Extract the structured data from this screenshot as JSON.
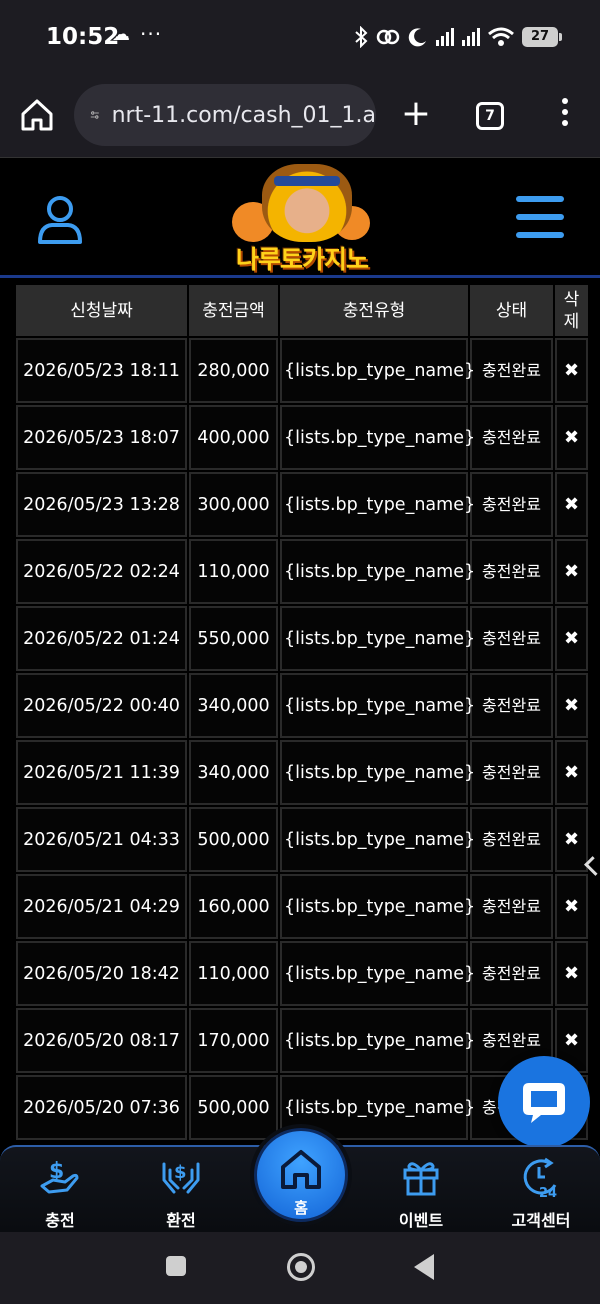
{
  "status_bar": {
    "time": "10:52",
    "cloud": "☁",
    "dots": "···",
    "battery": "27"
  },
  "browser": {
    "url": "nrt-11.com/cash_01_1.a",
    "tab_count": "7"
  },
  "site": {
    "logo_text": "나루토카지노",
    "accent_color": "#3d9cf0"
  },
  "table": {
    "headers": [
      "신청날짜",
      "충전금액",
      "충전유형",
      "상태",
      "삭\n제"
    ],
    "rows": [
      {
        "date": "2026/05/23 18:11",
        "amount": "280,000",
        "type": "{lists.bp_type_name}",
        "status": "충전완료",
        "delete": "✖"
      },
      {
        "date": "2026/05/23 18:07",
        "amount": "400,000",
        "type": "{lists.bp_type_name}",
        "status": "충전완료",
        "delete": "✖"
      },
      {
        "date": "2026/05/23 13:28",
        "amount": "300,000",
        "type": "{lists.bp_type_name}",
        "status": "충전완료",
        "delete": "✖"
      },
      {
        "date": "2026/05/22 02:24",
        "amount": "110,000",
        "type": "{lists.bp_type_name}",
        "status": "충전완료",
        "delete": "✖"
      },
      {
        "date": "2026/05/22 01:24",
        "amount": "550,000",
        "type": "{lists.bp_type_name}",
        "status": "충전완료",
        "delete": "✖"
      },
      {
        "date": "2026/05/22 00:40",
        "amount": "340,000",
        "type": "{lists.bp_type_name}",
        "status": "충전완료",
        "delete": "✖"
      },
      {
        "date": "2026/05/21 11:39",
        "amount": "340,000",
        "type": "{lists.bp_type_name}",
        "status": "충전완료",
        "delete": "✖"
      },
      {
        "date": "2026/05/21 04:33",
        "amount": "500,000",
        "type": "{lists.bp_type_name}",
        "status": "충전완료",
        "delete": "✖"
      },
      {
        "date": "2026/05/21 04:29",
        "amount": "160,000",
        "type": "{lists.bp_type_name}",
        "status": "충전완료",
        "delete": "✖"
      },
      {
        "date": "2026/05/20 18:42",
        "amount": "110,000",
        "type": "{lists.bp_type_name}",
        "status": "충전완료",
        "delete": "✖"
      },
      {
        "date": "2026/05/20 08:17",
        "amount": "170,000",
        "type": "{lists.bp_type_name}",
        "status": "충전완료",
        "delete": "✖"
      },
      {
        "date": "2026/05/20 07:36",
        "amount": "500,000",
        "type": "{lists.bp_type_name}",
        "status": "충전완료",
        "delete": "✖"
      }
    ]
  },
  "bottom_nav": {
    "charge": "충전",
    "exchange": "환전",
    "home": "홈",
    "event": "이벤트",
    "support": "고객센터"
  }
}
